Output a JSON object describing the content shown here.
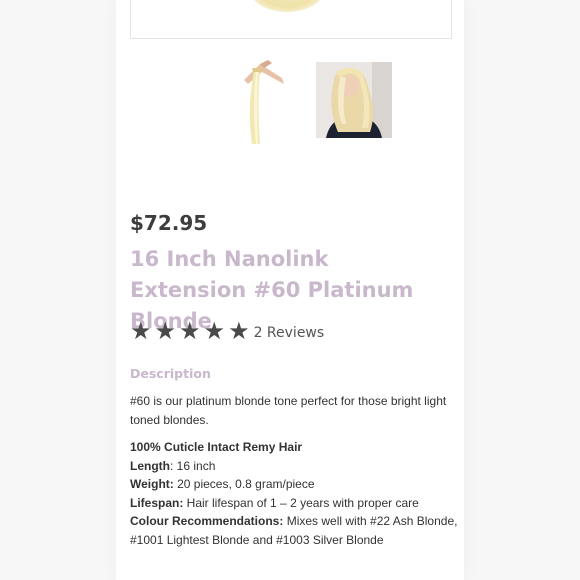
{
  "product": {
    "price": "$72.95",
    "title": "16 Inch Nanolink Extension #60 Platinum Blonde",
    "rating": 5,
    "reviews": "2 Reviews"
  },
  "description": {
    "heading": "Description",
    "intro": "#60 is our platinum blonde tone perfect for those bright light toned blondes.",
    "feature": "100% Cuticle Intact Remy Hair",
    "specs": [
      {
        "label": "Length",
        "value": ": 16 inch"
      },
      {
        "label": "Weight:",
        "value": " 20 pieces, 0.8 gram/piece"
      },
      {
        "label": "Lifespan:",
        "value": " Hair lifespan of 1 – 2 years with proper care"
      },
      {
        "label": "Colour Recommendations:",
        "value": " Mixes well with #22 Ash Blonde, #1001 Lightest Blonde and #1003 Silver Blonde"
      }
    ]
  },
  "colors": {
    "accent": "#c9b8cc",
    "text": "#333333",
    "stars": "#4a4a4a"
  },
  "icons": {
    "star": "star-icon"
  }
}
